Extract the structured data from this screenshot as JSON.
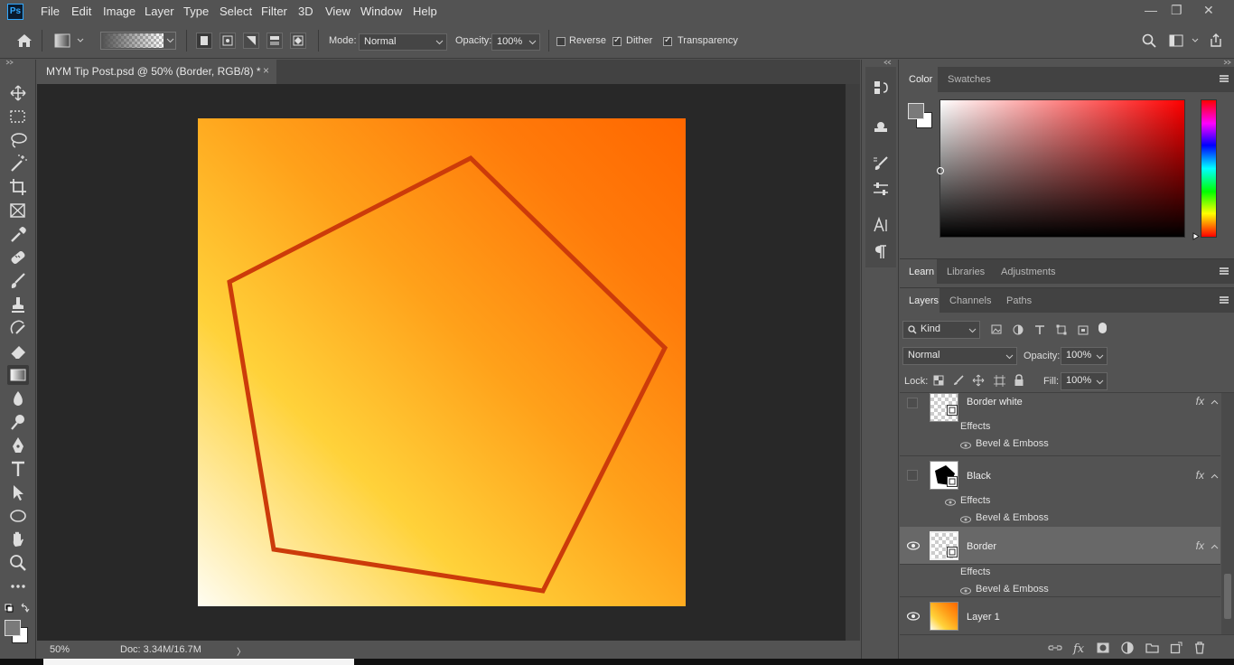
{
  "app": {
    "logo": "Ps",
    "menu": [
      "File",
      "Edit",
      "Image",
      "Layer",
      "Type",
      "Select",
      "Filter",
      "3D",
      "View",
      "Window",
      "Help"
    ],
    "window_controls": [
      "—",
      "❐",
      "✕"
    ]
  },
  "options": {
    "mode_label": "Mode:",
    "mode_value": "Normal",
    "opacity_label": "Opacity:",
    "opacity_value": "100%",
    "reverse_label": "Reverse",
    "reverse_checked": false,
    "dither_label": "Dither",
    "dither_checked": true,
    "transparency_label": "Transparency",
    "transparency_checked": true
  },
  "document": {
    "tab_title": "MYM Tip Post.psd @ 50% (Border, RGB/8) *",
    "close": "×",
    "zoom": "50%",
    "doc_info": "Doc: 3.34M/16.7M",
    "status_arrow": "〉",
    "pentagon_stroke": "#cc3b0a"
  },
  "color_panel": {
    "tabs": [
      "Color",
      "Swatches"
    ],
    "active_tab": "Color",
    "foreground": "#7a7a7a",
    "background": "#ffffff"
  },
  "learn_panel": {
    "tabs": [
      "Learn",
      "Libraries",
      "Adjustments"
    ]
  },
  "layers_panel": {
    "tabs": [
      "Layers",
      "Channels",
      "Paths"
    ],
    "filter_kind": "Kind",
    "blend_mode": "Normal",
    "opacity_label": "Opacity:",
    "opacity_value": "100%",
    "lock_label": "Lock:",
    "fill_label": "Fill:",
    "fill_value": "100%",
    "layers": [
      {
        "name": "Border white",
        "visible": false,
        "fx": "fx",
        "effects_label": "Effects",
        "effect": "Bevel & Emboss",
        "selected": false
      },
      {
        "name": "Black",
        "visible": false,
        "fx": "fx",
        "effects_label": "Effects",
        "effect": "Bevel & Emboss",
        "selected": false
      },
      {
        "name": "Border",
        "visible": true,
        "fx": "fx",
        "effects_label": "Effects",
        "effect": "Bevel & Emboss",
        "selected": true
      },
      {
        "name": "Layer 1",
        "visible": true,
        "selected": false
      }
    ]
  },
  "colors": {
    "accent_ps": "#31a8ff",
    "canvas_bg": "#282828",
    "panel_bg": "#535353"
  }
}
